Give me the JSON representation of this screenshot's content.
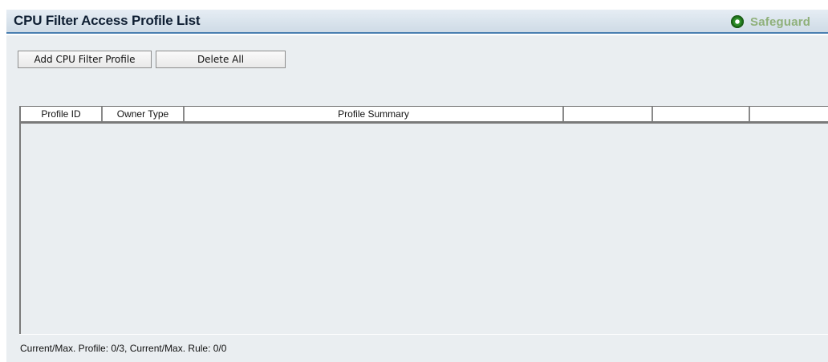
{
  "header": {
    "title": "CPU Filter Access Profile List",
    "safeguard_label": "Safeguard",
    "safeguard_status_color": "#2f8f2a"
  },
  "toolbar": {
    "add_label": "Add CPU Filter Profile",
    "delete_all_label": "Delete All"
  },
  "table": {
    "columns": [
      "Profile ID",
      "Owner Type",
      "Profile Summary",
      "",
      "",
      ""
    ],
    "rows": []
  },
  "status": {
    "text": "Current/Max. Profile: 0/3, Current/Max. Rule: 0/0"
  }
}
